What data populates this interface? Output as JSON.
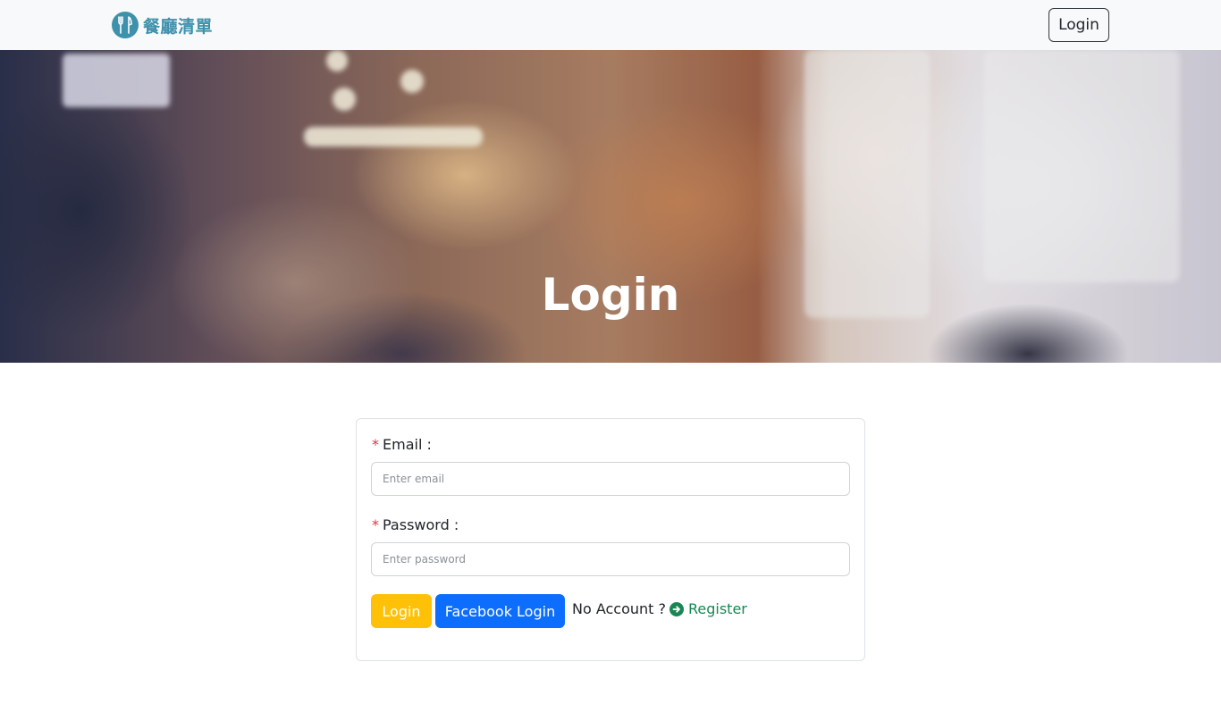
{
  "navbar": {
    "brand_text": "餐廳清單",
    "login_label": "Login"
  },
  "hero": {
    "title": "Login"
  },
  "form": {
    "email_label": "Email :",
    "email_placeholder": "Enter email",
    "email_value": "",
    "password_label": "Password :",
    "password_placeholder": "Enter password",
    "password_value": "",
    "required_mark": "*",
    "login_button": "Login",
    "facebook_button": "Facebook Login",
    "no_account_text": "No Account ?",
    "register_link": "Register"
  },
  "colors": {
    "brand": "#3e91ab",
    "login_button": "#ffc107",
    "facebook_button": "#0d6efd",
    "register_link": "#198754",
    "required_mark": "#dc3545",
    "navbar_bg": "#f8f9fa"
  },
  "icons": {
    "brand": "utensils-icon",
    "register": "arrow-circle-right-icon"
  }
}
